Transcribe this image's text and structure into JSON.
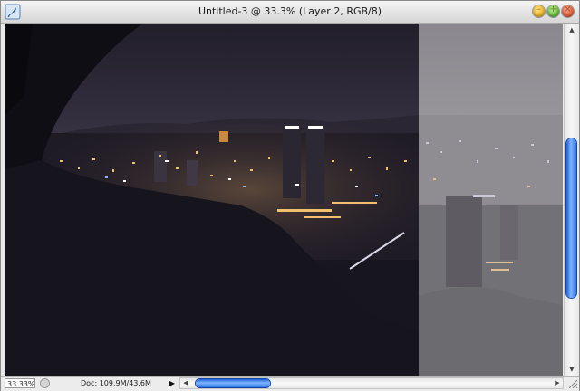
{
  "window": {
    "title": "Untitled-3 @ 33.3% (Layer 2, RGB/8)",
    "icons": {
      "app": "photoshop-feather-icon",
      "minimize": "minimize-icon",
      "maximize": "maximize-icon",
      "close": "close-icon"
    },
    "colors": {
      "minimize": "#f2b600",
      "maximize": "#56b82a",
      "close": "#e84d1c"
    }
  },
  "canvas": {
    "description_layers": [
      "dark adjusted layer",
      "original light layer"
    ],
    "colors": {
      "sky_dark": "#2f2a3a",
      "foreground_dark": "#17151d",
      "light_layer": "#7d7d82"
    }
  },
  "statusbar": {
    "zoom": "33.33%",
    "doc_info": "Doc: 109.9M/43.6M",
    "arrow_icon": "triangle-right-icon",
    "status_icon": "status-circle-icon"
  },
  "scrollbars": {
    "accent": "#2d72e8",
    "up_icon": "arrow-up-icon",
    "down_icon": "arrow-down-icon",
    "left_icon": "arrow-left-icon",
    "right_icon": "arrow-right-icon"
  }
}
